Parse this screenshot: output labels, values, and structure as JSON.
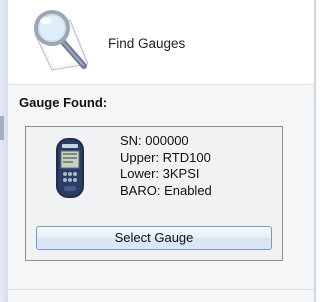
{
  "header": {
    "title": "Find Gauges",
    "icon": "magnifier-document-icon"
  },
  "section": {
    "label": "Gauge Found:"
  },
  "gauge": {
    "icon": "gauge-device-icon",
    "sn": "SN: 000000",
    "upper": "Upper: RTD100",
    "lower": "Lower: 3KPSI",
    "baro": "BARO: Enabled"
  },
  "actions": {
    "select_label": "Select Gauge"
  }
}
